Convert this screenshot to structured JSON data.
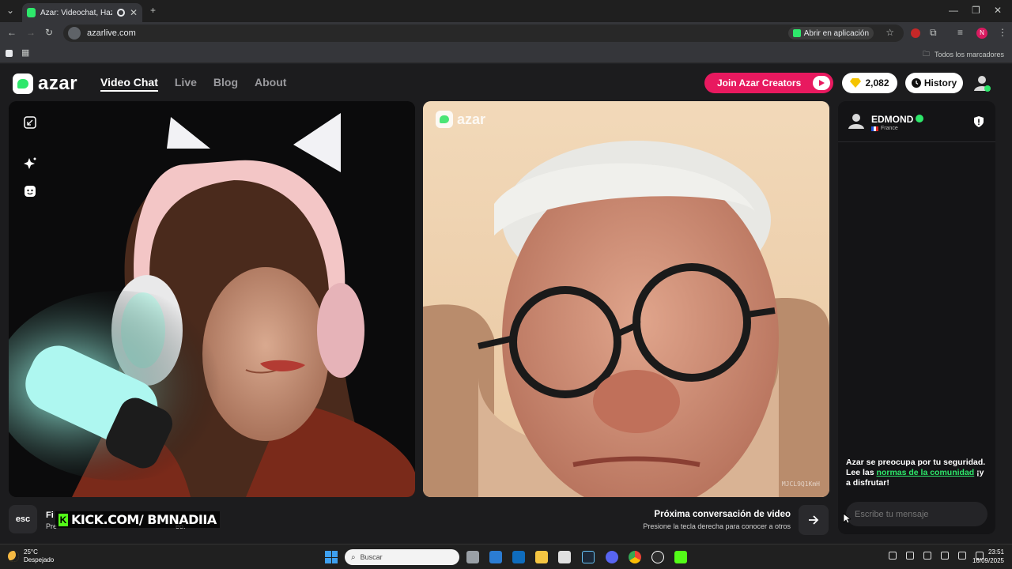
{
  "browser": {
    "tab_title": "Azar: Videochat, Haz nuevo",
    "url": "azarlive.com",
    "open_in_app": "Abrir en aplicación",
    "bookmarks_label": "Todos los marcadores"
  },
  "header": {
    "logo_text": "azar",
    "nav": [
      "Video Chat",
      "Live",
      "Blog",
      "About"
    ],
    "join_creators": "Join Azar Creators",
    "gems": "2,082",
    "history": "History"
  },
  "right_video": {
    "watermark": "azar",
    "code": "MJCL9Q1KmH"
  },
  "chat": {
    "peer_name": "EDMOND",
    "peer_country": "France",
    "safety_pre": "Azar se preocupa por tu seguridad. Lee las",
    "safety_link": "normas de la comunidad",
    "safety_post": "¡y a disfrutar!",
    "message_placeholder": "Escribe tu mensaje"
  },
  "bottom": {
    "esc_label": "esc",
    "tip_title": "Fi",
    "tip_sub": "Pre",
    "tip_sub_tail": "eo.",
    "kick_overlay": "KICK.COM/ BMNADIIA",
    "next_title": "Próxima conversación de video",
    "next_sub": "Presione la tecla derecha para conocer a otros"
  },
  "taskbar": {
    "temperature": "25°C",
    "weather": "Despejado",
    "search_placeholder": "Buscar",
    "time": "23:51",
    "date": "16/09/2025"
  },
  "colors": {
    "brand_green": "#2ee86b",
    "creators_pink": "#e8195f",
    "page_bg": "#1c1c1e"
  }
}
